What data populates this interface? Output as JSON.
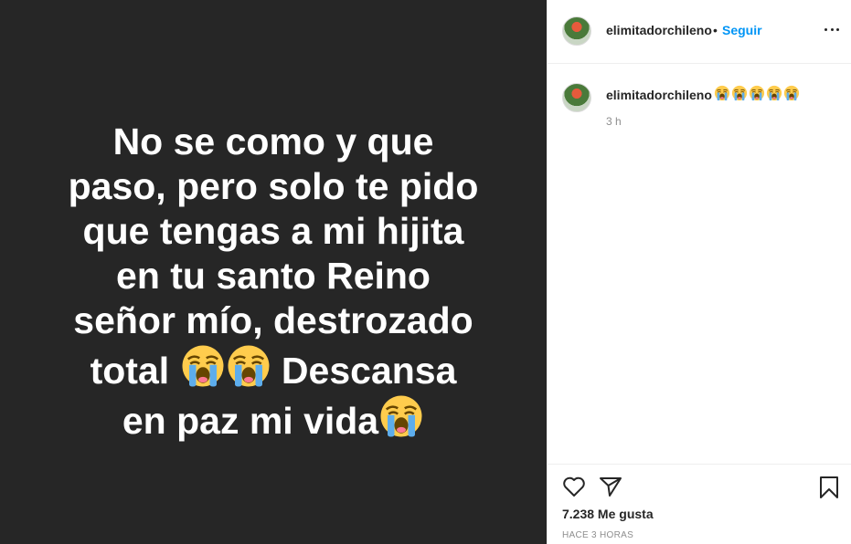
{
  "post": {
    "lines": [
      "No se como y que",
      "paso, pero solo te pido",
      "que tengas a mi hijita",
      "en tu santo Reino",
      "señor mío, destrozado"
    ],
    "line6_start": "total ",
    "line6_end": " Descansa",
    "line7": "en paz mi vida",
    "background_color": "#262626",
    "text_color": "#ffffff"
  },
  "header": {
    "username": "elimitadorchileno",
    "separator": "•",
    "follow_label": "Seguir",
    "more_icon": "more-options-icon"
  },
  "caption": {
    "username": "elimitadorchileno",
    "emoji_count": 5,
    "emoji_name": "loudly-crying-face-icon",
    "time": "3 h"
  },
  "actions": {
    "like_icon": "heart-icon",
    "share_icon": "paper-plane-icon",
    "save_icon": "bookmark-icon",
    "likes_text": "7.238 Me gusta",
    "timestamp": "HACE 3 HORAS"
  },
  "colors": {
    "accent": "#0095f6",
    "muted": "#8e8e8e",
    "text": "#262626",
    "border": "#efefef"
  }
}
